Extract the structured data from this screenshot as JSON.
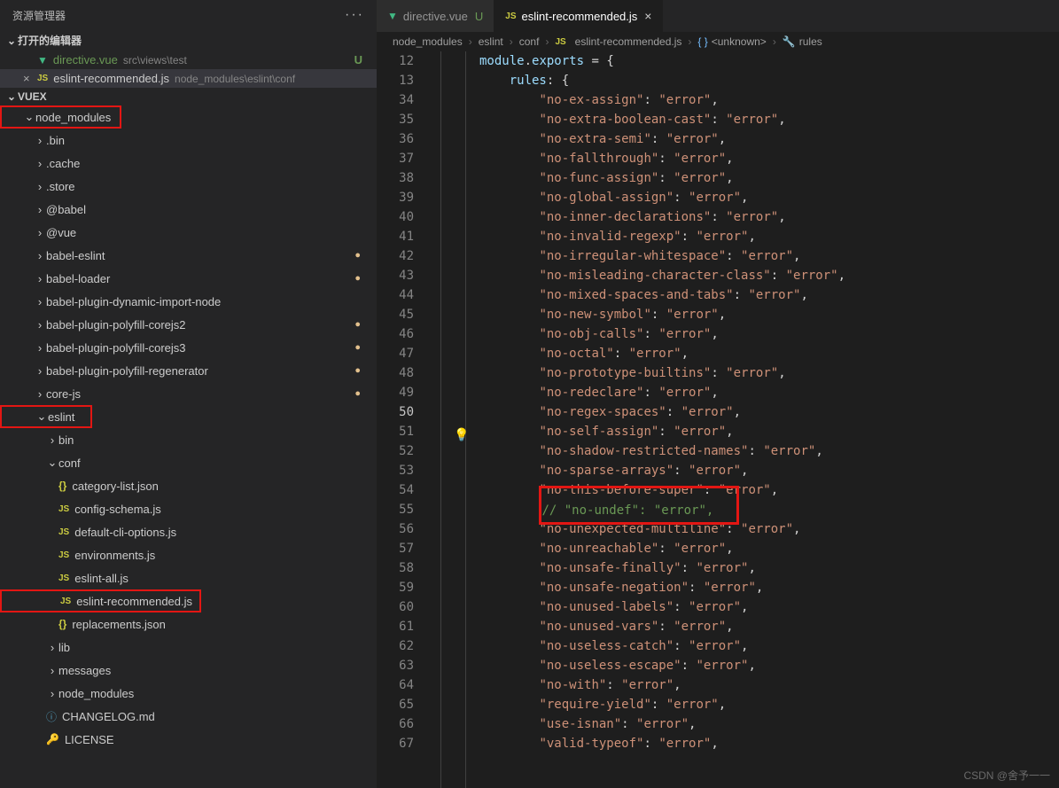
{
  "sidebar": {
    "title": "资源管理器",
    "open_editors_label": "打开的编辑器",
    "open_editors": [
      {
        "icon": "vue",
        "name": "directive.vue",
        "path": "src\\views\\test",
        "badge": "U"
      },
      {
        "icon": "js",
        "name": "eslint-recommended.js",
        "path": "node_modules\\eslint\\conf",
        "badge": ""
      }
    ],
    "project_label": "VUEX",
    "tree": {
      "node_modules": "node_modules",
      "bin": ".bin",
      "cache": ".cache",
      "store": ".store",
      "babel": "@babel",
      "vue": "@vue",
      "babel_eslint": "babel-eslint",
      "babel_loader": "babel-loader",
      "babel_dyn": "babel-plugin-dynamic-import-node",
      "babel_poly2": "babel-plugin-polyfill-corejs2",
      "babel_poly3": "babel-plugin-polyfill-corejs3",
      "babel_regen": "babel-plugin-polyfill-regenerator",
      "corejs": "core-js",
      "eslint": "eslint",
      "eslint_bin": "bin",
      "eslint_conf": "conf",
      "f_category": "category-list.json",
      "f_config": "config-schema.js",
      "f_default": "default-cli-options.js",
      "f_env": "environments.js",
      "f_all": "eslint-all.js",
      "f_rec": "eslint-recommended.js",
      "f_repl": "replacements.json",
      "eslint_lib": "lib",
      "eslint_msg": "messages",
      "eslint_nm": "node_modules",
      "changelog": "CHANGELOG.md",
      "license": "LICENSE"
    }
  },
  "tabs": [
    {
      "icon": "vue",
      "name": "directive.vue",
      "badge": "U"
    },
    {
      "icon": "js",
      "name": "eslint-recommended.js",
      "badge": "×"
    }
  ],
  "breadcrumb": {
    "p1": "node_modules",
    "p2": "eslint",
    "p3": "conf",
    "file": "eslint-recommended.js",
    "sym1": "<unknown>",
    "sym2": "rules"
  },
  "code": {
    "line12_a": "module",
    "line12_b": ".",
    "line12_c": "exports",
    "line12_d": " = {",
    "line13_a": "rules",
    "line13_b": ": {",
    "pad8": "        ",
    "pad4": "    ",
    "rules": [
      {
        "k": "no-ex-assign",
        "v": "error"
      },
      {
        "k": "no-extra-boolean-cast",
        "v": "error"
      },
      {
        "k": "no-extra-semi",
        "v": "error"
      },
      {
        "k": "no-fallthrough",
        "v": "error"
      },
      {
        "k": "no-func-assign",
        "v": "error"
      },
      {
        "k": "no-global-assign",
        "v": "error"
      },
      {
        "k": "no-inner-declarations",
        "v": "error"
      },
      {
        "k": "no-invalid-regexp",
        "v": "error"
      },
      {
        "k": "no-irregular-whitespace",
        "v": "error"
      },
      {
        "k": "no-misleading-character-class",
        "v": "error"
      },
      {
        "k": "no-mixed-spaces-and-tabs",
        "v": "error"
      },
      {
        "k": "no-new-symbol",
        "v": "error"
      },
      {
        "k": "no-obj-calls",
        "v": "error"
      },
      {
        "k": "no-octal",
        "v": "error"
      },
      {
        "k": "no-prototype-builtins",
        "v": "error"
      },
      {
        "k": "no-redeclare",
        "v": "error"
      },
      {
        "k": "no-regex-spaces",
        "v": "error"
      },
      {
        "k": "no-self-assign",
        "v": "error"
      },
      {
        "k": "no-shadow-restricted-names",
        "v": "error"
      },
      {
        "k": "no-sparse-arrays",
        "v": "error"
      },
      {
        "k": "no-this-before-super",
        "v": "error"
      }
    ],
    "comment_line": "// \"no-undef\": \"error\",",
    "rules_after": [
      {
        "k": "no-unexpected-multiline",
        "v": "error"
      },
      {
        "k": "no-unreachable",
        "v": "error"
      },
      {
        "k": "no-unsafe-finally",
        "v": "error"
      },
      {
        "k": "no-unsafe-negation",
        "v": "error"
      },
      {
        "k": "no-unused-labels",
        "v": "error"
      },
      {
        "k": "no-unused-vars",
        "v": "error"
      },
      {
        "k": "no-useless-catch",
        "v": "error"
      },
      {
        "k": "no-useless-escape",
        "v": "error"
      },
      {
        "k": "no-with",
        "v": "error"
      },
      {
        "k": "require-yield",
        "v": "error"
      },
      {
        "k": "use-isnan",
        "v": "error"
      },
      {
        "k": "valid-typeof",
        "v": "error"
      }
    ],
    "line_numbers": [
      "12",
      "13",
      "34",
      "35",
      "36",
      "37",
      "38",
      "39",
      "40",
      "41",
      "42",
      "43",
      "44",
      "45",
      "46",
      "47",
      "48",
      "49",
      "50",
      "51",
      "52",
      "53",
      "54",
      "55",
      "56",
      "57",
      "58",
      "59",
      "60",
      "61",
      "62",
      "63",
      "64",
      "65",
      "66",
      "67"
    ]
  },
  "watermark": "CSDN @舍予一一"
}
